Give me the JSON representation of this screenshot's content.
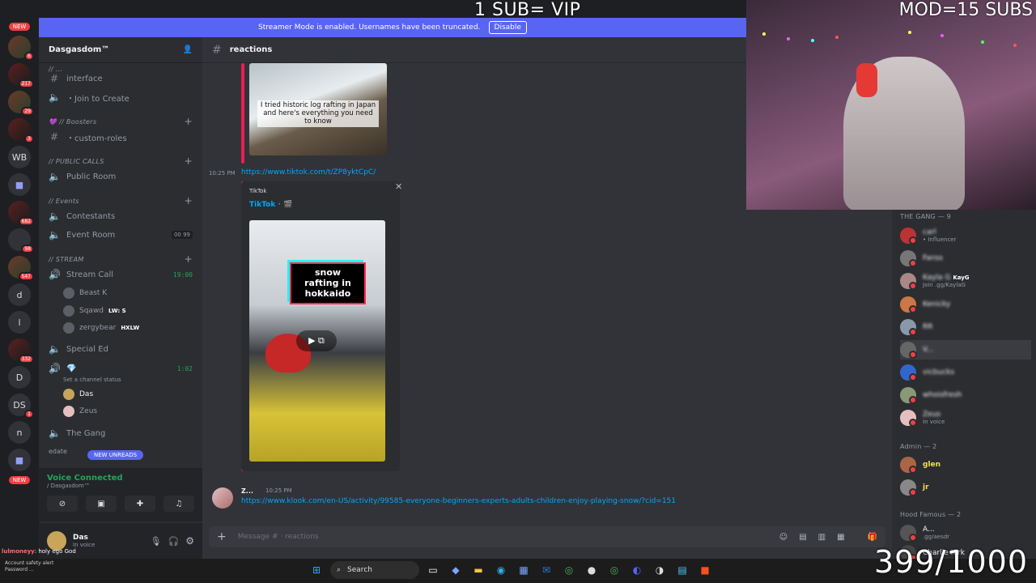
{
  "overlay": {
    "top_text": "1 SUB= VIP",
    "mod_text": "MOD=15 SUBS",
    "count_text": "399/1000"
  },
  "banner": {
    "text": "Streamer Mode is enabled. Usernames have been truncated.",
    "disable_label": "Disable"
  },
  "servers": {
    "new_top": "NEW",
    "badges": [
      "6",
      "217",
      "29",
      "3",
      "682",
      "98",
      "547",
      "332",
      "1"
    ],
    "letters": [
      "WB",
      "d",
      "l",
      "D",
      "DS",
      "n"
    ],
    "new_bottom": "NEW"
  },
  "guild": {
    "name": "Dasgasdom™"
  },
  "channels": {
    "cat_top": "// ...",
    "interface": "interface",
    "join_to_create": "・Join to Create",
    "cat_boosters": "💜 // Boosters",
    "custom_roles": "・custom-roles",
    "cat_public_calls": "// PUBLIC CALLS",
    "public_room": "Public Room",
    "cat_events": "// Events",
    "contestants": "Contestants",
    "event_room": "Event Room",
    "event_room_count": "00  99",
    "cat_stream": "// STREAM",
    "stream_call": "Stream Call",
    "stream_call_time": "19:00",
    "beast": "Beast K",
    "sqawd": "Sqawd",
    "sqawd_tag": "LW: S",
    "zergybear": "zergybear",
    "zergy_tag": "HXLW",
    "special_ed": "Special Ed",
    "diamond_time": "1:02",
    "set_status": "Set a channel status",
    "das": "Das",
    "zeus": "Zeus",
    "the_gang": "The Gang",
    "edate": "edate",
    "new_unreads": "NEW UNREADS"
  },
  "voice": {
    "connected": "Voice Connected",
    "server": "/ Dasgasdom™"
  },
  "user": {
    "name": "Das",
    "status": "In voice"
  },
  "chat": {
    "channel_name": "reactions",
    "thumb1_caption": "I tried historic log rafting in Japan and here's everything you need to know",
    "msg_time": "10:25 PM",
    "tiktok_link": "https://www.tiktok.com/t/ZP8yktCpC/",
    "embed_provider": "TikTok",
    "embed_title": "TikTok · 🎬",
    "thumb2_caption": "snow rafting in hokkaido",
    "msg2_user": "Z...",
    "msg2_time": "10:25 PM",
    "msg2_link": "https://www.klook.com/en-US/activity/99585-everyone-beginners-experts-adults-children-enjoy-playing-snow/?cid=151",
    "input_placeholder": "Message # · reactions"
  },
  "members": {
    "cat_gang": "THE GANG — 9",
    "gang": [
      {
        "name": "carl",
        "status": "• Influencer"
      },
      {
        "name": "Fanss",
        "status": ""
      },
      {
        "name": "Kayla G",
        "status": "Join .gg/KaylaG",
        "tag": "KayG"
      },
      {
        "name": "Kenicky",
        "status": ""
      },
      {
        "name": "RR",
        "status": ""
      },
      {
        "name": "V...",
        "status": ""
      },
      {
        "name": "vicbucks",
        "status": ""
      },
      {
        "name": "whoisfresh",
        "status": ""
      },
      {
        "name": "Zeus",
        "status": "In voice"
      }
    ],
    "cat_admin": "Admin — 2",
    "admin": [
      {
        "name": "glen"
      },
      {
        "name": "jr"
      }
    ],
    "cat_hood": "Hood Famous — 2",
    "hood": [
      {
        "name": "A...",
        "status": ".gg/aesdr"
      },
      {
        "name": "Charlie Kirk",
        "status": ""
      }
    ]
  },
  "chat_overlay": {
    "line1_user": "lulmoneyy",
    "line1_text": ": holy ego God",
    "line2": "Account safety alert",
    "line3": "Password ..."
  },
  "taskbar": {
    "search_label": "Search"
  },
  "colors": {
    "brand": "#5865f2",
    "online": "#23a55a",
    "dnd": "#f23f43",
    "link": "#00a8fc",
    "tiktok": "#ee1d52"
  }
}
